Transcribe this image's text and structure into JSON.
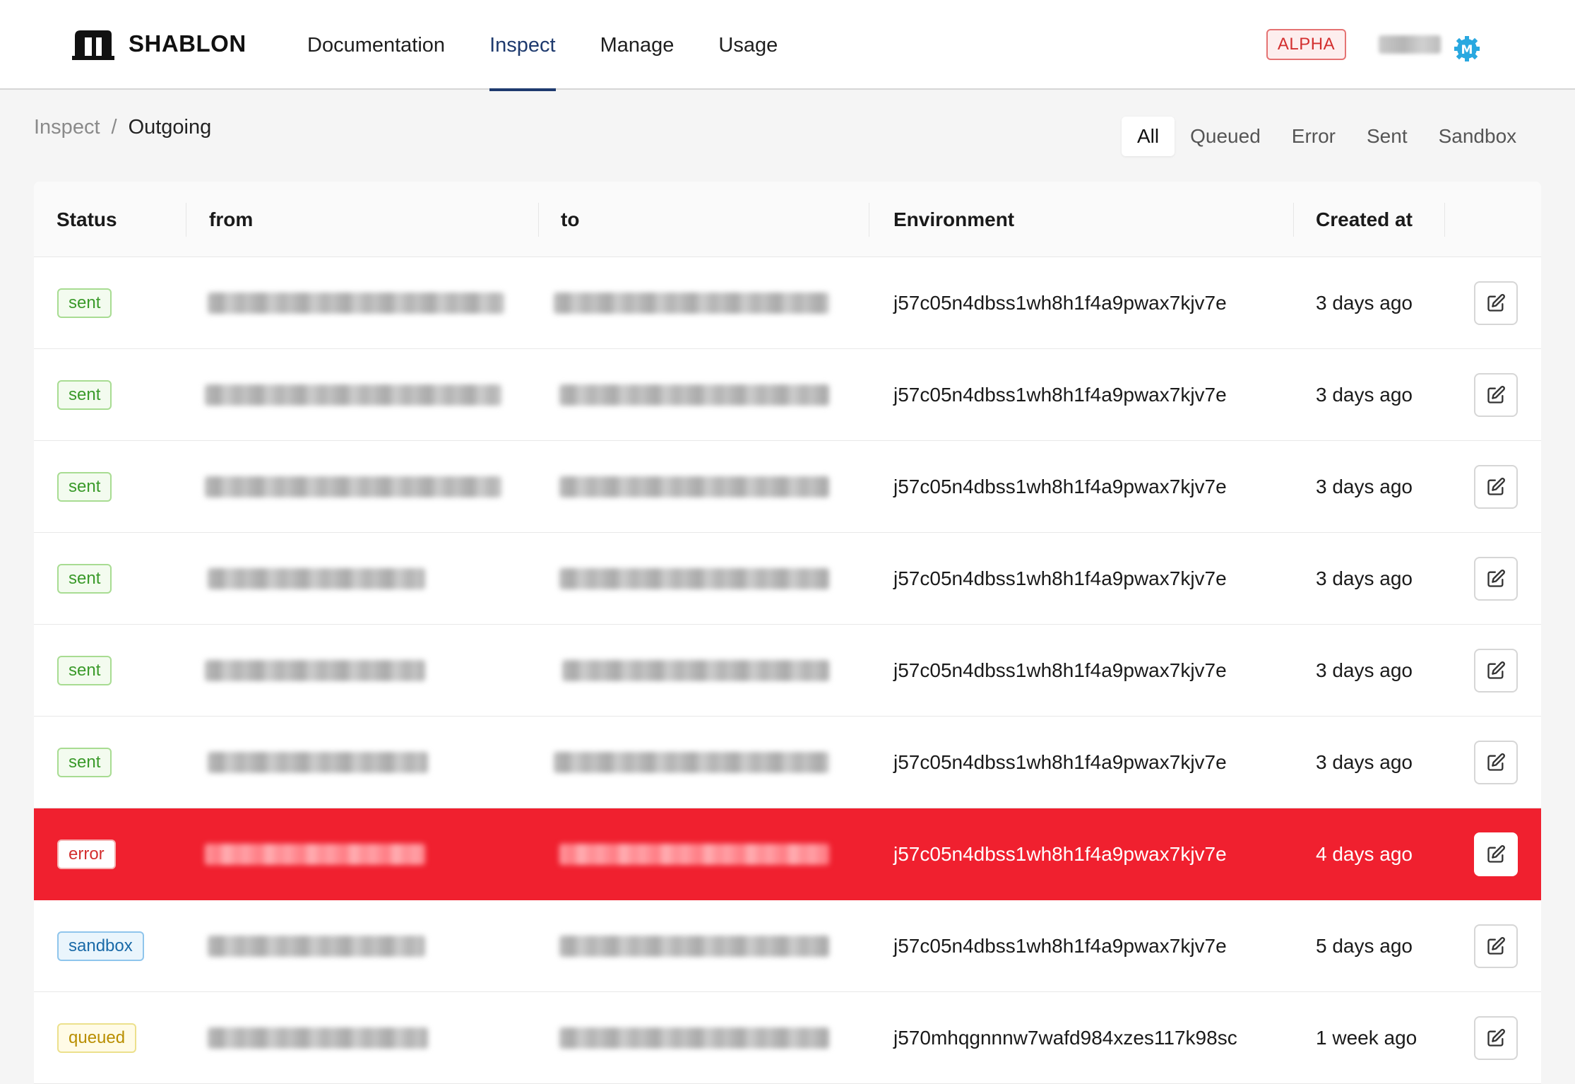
{
  "app": {
    "name": "SHABLON",
    "badge": "ALPHA"
  },
  "nav": {
    "items": [
      {
        "label": "Documentation",
        "active": false
      },
      {
        "label": "Inspect",
        "active": true
      },
      {
        "label": "Manage",
        "active": false
      },
      {
        "label": "Usage",
        "active": false
      }
    ]
  },
  "user": {
    "avatar_initial": "M",
    "avatar_color": "#29a8e0"
  },
  "breadcrumb": {
    "parent": "Inspect",
    "separator": "/",
    "current": "Outgoing"
  },
  "filters": [
    {
      "label": "All",
      "active": true
    },
    {
      "label": "Queued",
      "active": false
    },
    {
      "label": "Error",
      "active": false
    },
    {
      "label": "Sent",
      "active": false
    },
    {
      "label": "Sandbox",
      "active": false
    }
  ],
  "table": {
    "columns": [
      "Status",
      "from",
      "to",
      "Environment",
      "Created at"
    ],
    "rows": [
      {
        "status": "sent",
        "environment": "j57c05n4dbss1wh8h1f4a9pwax7kjv7e",
        "created_at": "3 days ago"
      },
      {
        "status": "sent",
        "environment": "j57c05n4dbss1wh8h1f4a9pwax7kjv7e",
        "created_at": "3 days ago"
      },
      {
        "status": "sent",
        "environment": "j57c05n4dbss1wh8h1f4a9pwax7kjv7e",
        "created_at": "3 days ago"
      },
      {
        "status": "sent",
        "environment": "j57c05n4dbss1wh8h1f4a9pwax7kjv7e",
        "created_at": "3 days ago"
      },
      {
        "status": "sent",
        "environment": "j57c05n4dbss1wh8h1f4a9pwax7kjv7e",
        "created_at": "3 days ago"
      },
      {
        "status": "sent",
        "environment": "j57c05n4dbss1wh8h1f4a9pwax7kjv7e",
        "created_at": "3 days ago"
      },
      {
        "status": "error",
        "environment": "j57c05n4dbss1wh8h1f4a9pwax7kjv7e",
        "created_at": "4 days ago"
      },
      {
        "status": "sandbox",
        "environment": "j57c05n4dbss1wh8h1f4a9pwax7kjv7e",
        "created_at": "5 days ago"
      },
      {
        "status": "queued",
        "environment": "j570mhqgnnnw7wafd984xzes117k98sc",
        "created_at": "1 week ago"
      }
    ]
  },
  "colors": {
    "accent": "#1e3a6e",
    "error_row": "#f0202f",
    "sent": "#3a9a2a",
    "error": "#d32f2f",
    "sandbox": "#1a6aa8",
    "queued": "#b98e00"
  }
}
